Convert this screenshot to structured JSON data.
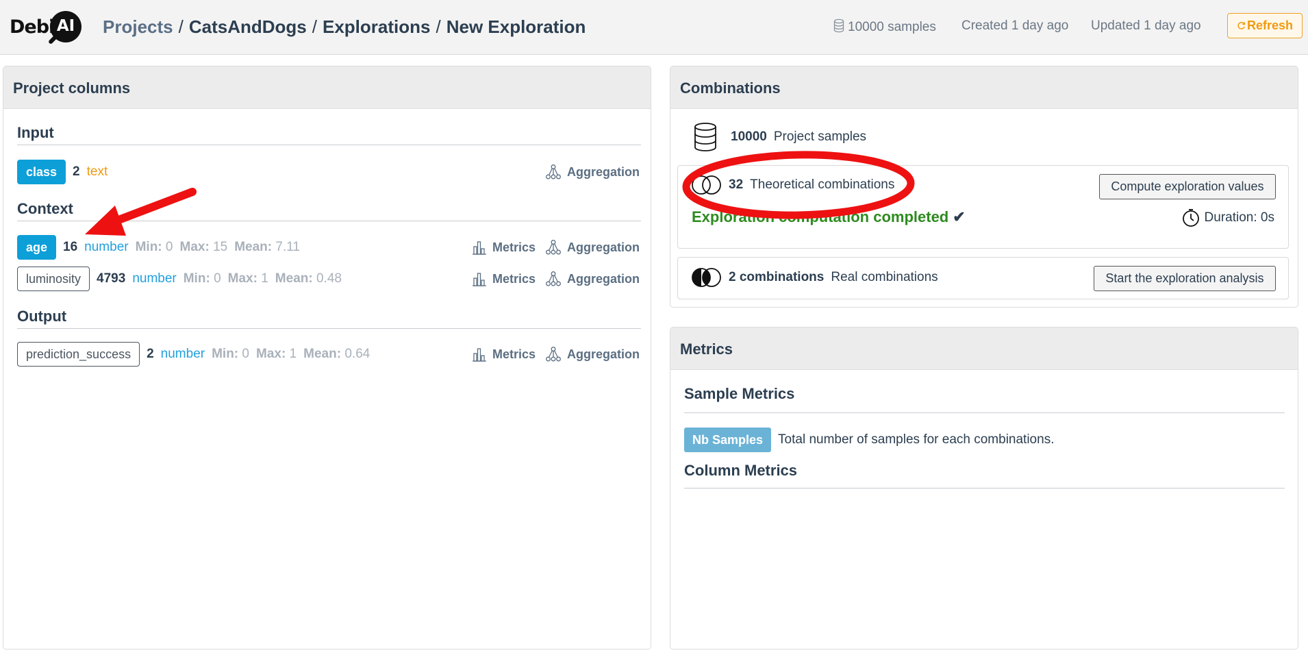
{
  "header": {
    "logo_text": "Debi",
    "logo_ai": "AI",
    "breadcrumb": [
      "Projects",
      "CatsAndDogs",
      "Explorations",
      "New Exploration"
    ],
    "samples": "10000 samples",
    "created": "Created 1 day ago",
    "updated": "Updated 1 day ago",
    "refresh_label": "Refresh"
  },
  "columns_panel": {
    "title": "Project columns",
    "input_title": "Input",
    "context_title": "Context",
    "output_title": "Output",
    "metrics_label": "Metrics",
    "aggregation_label": "Aggregation",
    "labels": {
      "min": "Min:",
      "max": "Max:",
      "mean": "Mean:"
    },
    "input": [
      {
        "name": "class",
        "count": "2",
        "type": "text"
      }
    ],
    "context": [
      {
        "name": "age",
        "count": "16",
        "type": "number",
        "min": "0",
        "max": "15",
        "mean": "7.11"
      },
      {
        "name": "luminosity",
        "count": "4793",
        "type": "number",
        "min": "0",
        "max": "1",
        "mean": "0.48"
      }
    ],
    "output": [
      {
        "name": "prediction_success",
        "count": "2",
        "type": "number",
        "min": "0",
        "max": "1",
        "mean": "0.64"
      }
    ]
  },
  "combinations_panel": {
    "title": "Combinations",
    "project_samples_count": "10000",
    "project_samples_label": "Project samples",
    "theoretical_count": "32",
    "theoretical_label": "Theoretical combinations",
    "compute_button": "Compute exploration values",
    "completed_text": "Exploration computation completed",
    "duration": "Duration: 0s",
    "real_count": "2 combinations",
    "real_label": "Real combinations",
    "start_button": "Start the exploration analysis"
  },
  "metrics_panel": {
    "title": "Metrics",
    "sample_metrics_title": "Sample Metrics",
    "nb_samples_badge": "Nb Samples",
    "nb_samples_desc": "Total number of samples for each combinations.",
    "column_metrics_title": "Column Metrics"
  },
  "colors": {
    "accent_blue": "#0d9fd8",
    "text_type": "#f09a10",
    "success_green": "#2e8b1f",
    "annotation_red": "#ee1111"
  }
}
